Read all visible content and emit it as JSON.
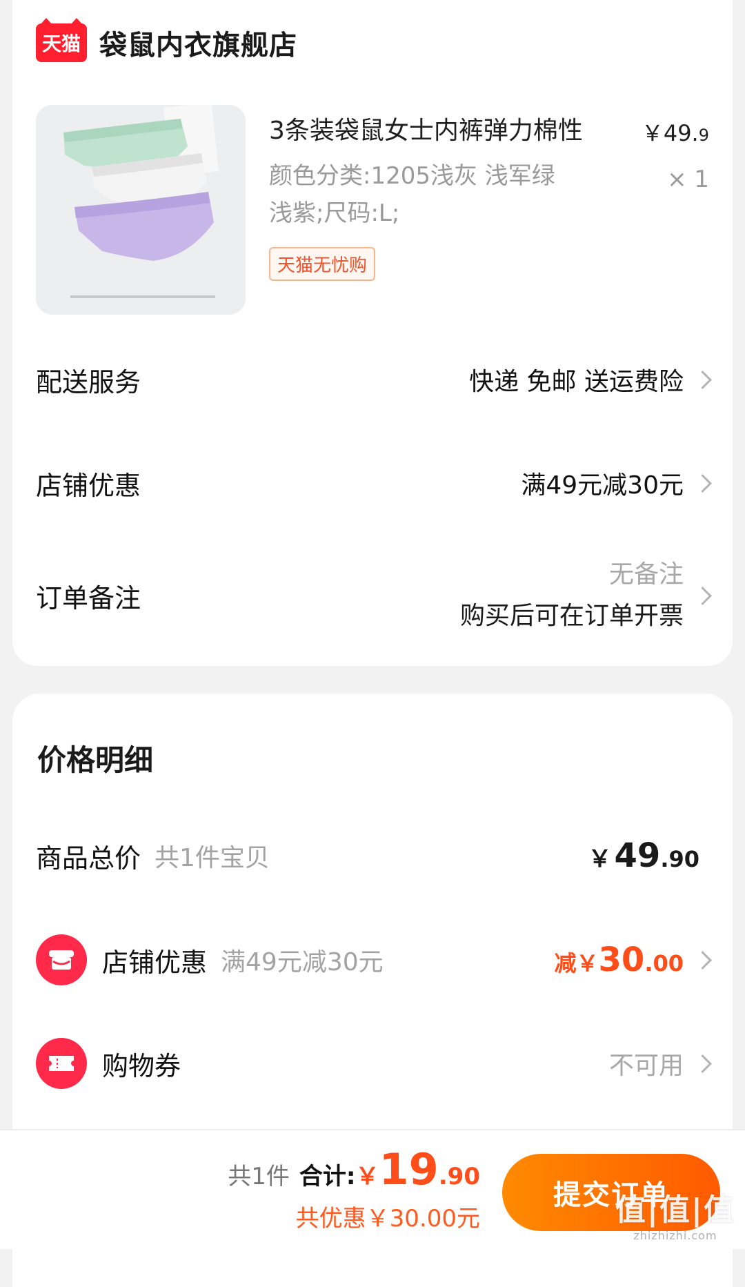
{
  "store": {
    "logo_text": "天猫",
    "name": "袋鼠内衣旗舰店"
  },
  "product": {
    "title": "3条装袋鼠女士内裤弹力棉性",
    "price_yen": "￥",
    "price_main": "49.",
    "price_dec": "9",
    "spec": "颜色分类:1205浅灰 浅军绿 浅紫;尺码:L;",
    "qty": "× 1",
    "tag": "天猫无忧购"
  },
  "rows": {
    "delivery_label": "配送服务",
    "delivery_value": "快递 免邮 送运费险",
    "store_discount_label": "店铺优惠",
    "store_discount_value": "满49元减30元",
    "note_label": "订单备注",
    "note_line1": "无备注",
    "note_line2": "购买后可在订单开票"
  },
  "price_detail": {
    "title": "价格明细",
    "goods_total_label": "商品总价",
    "goods_total_sub": "共1件宝贝",
    "goods_total_yen": "￥",
    "goods_total_main": "49",
    "goods_total_dec": ".90",
    "store_discount_label": "店铺优惠",
    "store_discount_sub": "满49元减30元",
    "store_discount_pre": "减￥",
    "store_discount_main": "30",
    "store_discount_dec": ".00",
    "coupon_label": "购物券",
    "coupon_value": "不可用"
  },
  "bottom": {
    "count": "共1件",
    "total_label": "合计:",
    "total_yen": "￥",
    "total_main": "19",
    "total_dec": ".90",
    "saved": "共优惠￥30.00元",
    "submit": "提交订单"
  },
  "watermark": {
    "main": "值|值|值",
    "sub": "zhizhizhi.com"
  },
  "colors": {
    "accent_red": "#ff2a4a",
    "accent_orange": "#ff5a00",
    "tmall_red": "#ff1f2f"
  }
}
